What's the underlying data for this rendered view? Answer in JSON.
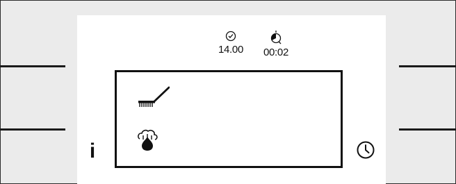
{
  "status": {
    "clock_icon": "clock-icon",
    "time": "14.00",
    "timer_icon": "timer-icon",
    "remaining": "00:02"
  },
  "display": {
    "programs": [
      {
        "icon": "brush-icon"
      },
      {
        "icon": "steam-icon"
      }
    ]
  },
  "controls": {
    "info_label": "i",
    "clock_button_icon": "clock-icon"
  },
  "colors": {
    "screen": "#ffffff",
    "bezel": "#ebebeb",
    "ink": "#111111"
  }
}
